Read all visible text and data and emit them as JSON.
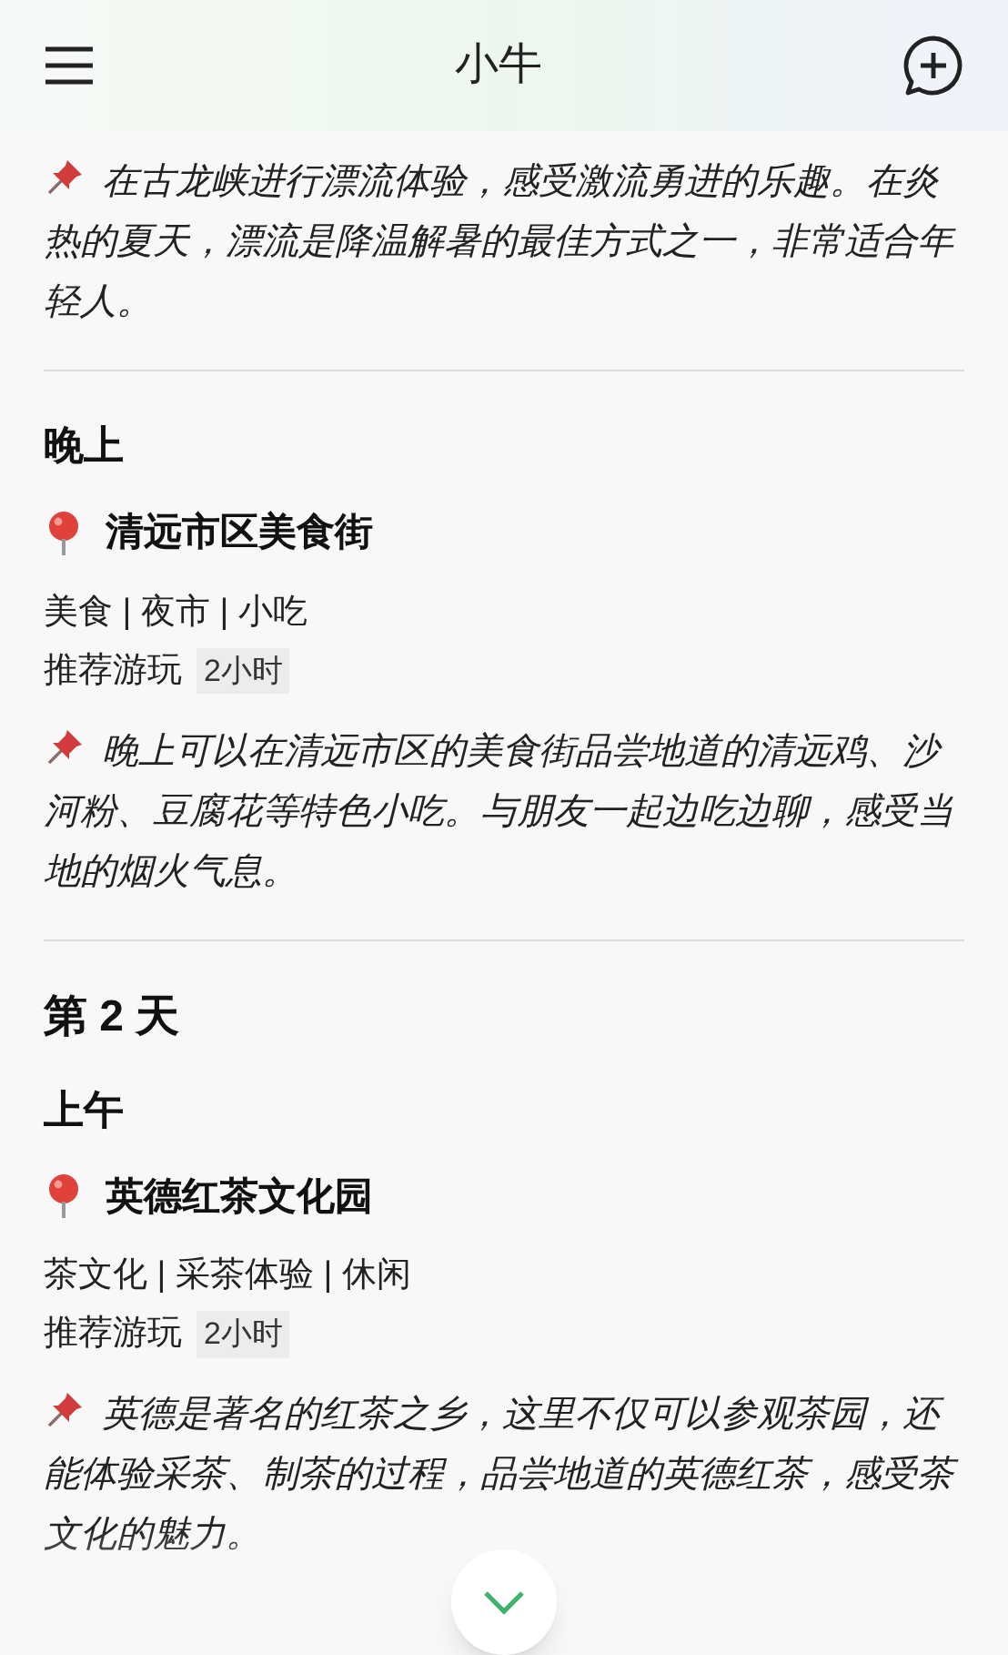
{
  "header": {
    "title": "小牛"
  },
  "blocks": [
    {
      "kind": "note",
      "text": "在古龙峡进行漂流体验，感受激流勇进的乐趣。在炎热的夏天，漂流是降温解暑的最佳方式之一，非常适合年轻人。"
    },
    {
      "kind": "divider"
    },
    {
      "kind": "period",
      "text": "晚上"
    },
    {
      "kind": "place",
      "text": "清远市区美食街"
    },
    {
      "kind": "tags",
      "text": "美食 | 夜市 | 小吃"
    },
    {
      "kind": "duration",
      "label": "推荐游玩",
      "value": "2小时"
    },
    {
      "kind": "note",
      "text": "晚上可以在清远市区的美食街品尝地道的清远鸡、沙河粉、豆腐花等特色小吃。与朋友一起边吃边聊，感受当地的烟火气息。"
    },
    {
      "kind": "divider"
    },
    {
      "kind": "day",
      "text": "第 2 天"
    },
    {
      "kind": "period",
      "text": "上午"
    },
    {
      "kind": "place",
      "text": "英德红茶文化园"
    },
    {
      "kind": "tags",
      "text": "茶文化 | 采茶体验 | 休闲"
    },
    {
      "kind": "duration",
      "label": "推荐游玩",
      "value": "2小时"
    },
    {
      "kind": "note",
      "text": "英德是著名的红茶之乡，这里不仅可以参观茶园，还能体验采茶、制茶的过程，品尝地道的英德红茶，感受茶文化的魅力。"
    }
  ]
}
